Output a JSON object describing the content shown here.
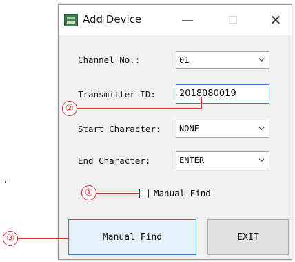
{
  "window": {
    "title": "Add Device",
    "minimize_glyph": "—",
    "maximize_glyph": "☐",
    "close_glyph": "✕",
    "app_icon": "device-icon"
  },
  "form": {
    "channel_label": "Channel No.:",
    "channel_value": "01",
    "transmitter_label": "Transmitter ID:",
    "transmitter_value": "2018080019",
    "start_char_label": "Start Character:",
    "start_char_value": "NONE",
    "end_char_label": "End Character:",
    "end_char_value": "ENTER",
    "manual_find_checkbox_label": "Manual Find",
    "manual_find_checked": false
  },
  "buttons": {
    "manual_find": "Manual Find",
    "exit": "EXIT"
  },
  "callouts": {
    "one": "①",
    "two": "②",
    "three": "③",
    "color": "#d8302e"
  },
  "colors": {
    "focus_border": "#3c7fd1",
    "button_highlight": "#e5f1fb"
  }
}
